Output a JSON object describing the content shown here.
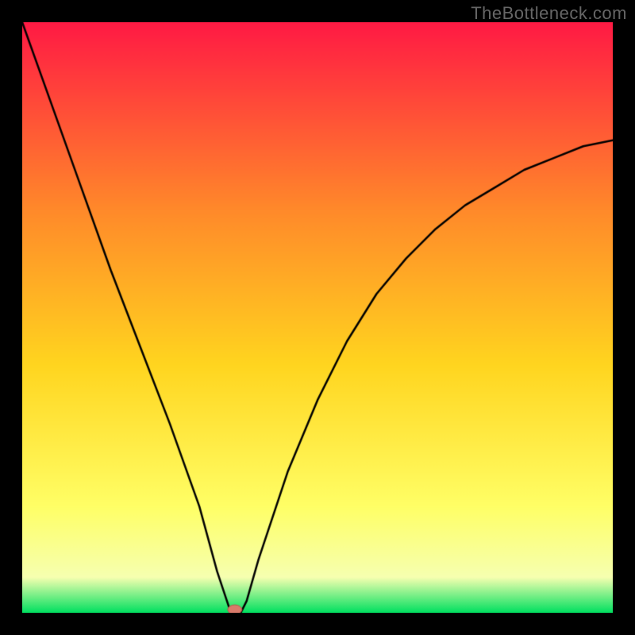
{
  "watermark": "TheBottleneck.com",
  "gradient": {
    "top": "#ff1a44",
    "upper_mid": "#ff8a2a",
    "mid": "#ffd51f",
    "lower_mid": "#ffff66",
    "pale": "#f6ffb0",
    "bottom": "#00e060"
  },
  "curve": {
    "color": "#000000",
    "width": 2.5
  },
  "marker": {
    "color": "#d87a6a",
    "rx": 9,
    "ry": 6,
    "stroke": "#b45a4a"
  },
  "chart_data": {
    "type": "line",
    "title": "",
    "xlabel": "",
    "ylabel": "",
    "xlim": [
      0,
      100
    ],
    "ylim": [
      0,
      100
    ],
    "series": [
      {
        "name": "bottleneck-curve",
        "x": [
          0,
          5,
          10,
          15,
          20,
          25,
          30,
          33,
          35,
          36,
          37,
          38,
          40,
          45,
          50,
          55,
          60,
          65,
          70,
          75,
          80,
          85,
          90,
          95,
          100
        ],
        "y": [
          100,
          86,
          72,
          58,
          45,
          32,
          18,
          7,
          1,
          0,
          0,
          2,
          9,
          24,
          36,
          46,
          54,
          60,
          65,
          69,
          72,
          75,
          77,
          79,
          80
        ]
      }
    ],
    "annotations": [
      {
        "name": "sweet-spot-marker",
        "x": 36,
        "y": 0
      }
    ],
    "grid": false,
    "legend": false
  }
}
